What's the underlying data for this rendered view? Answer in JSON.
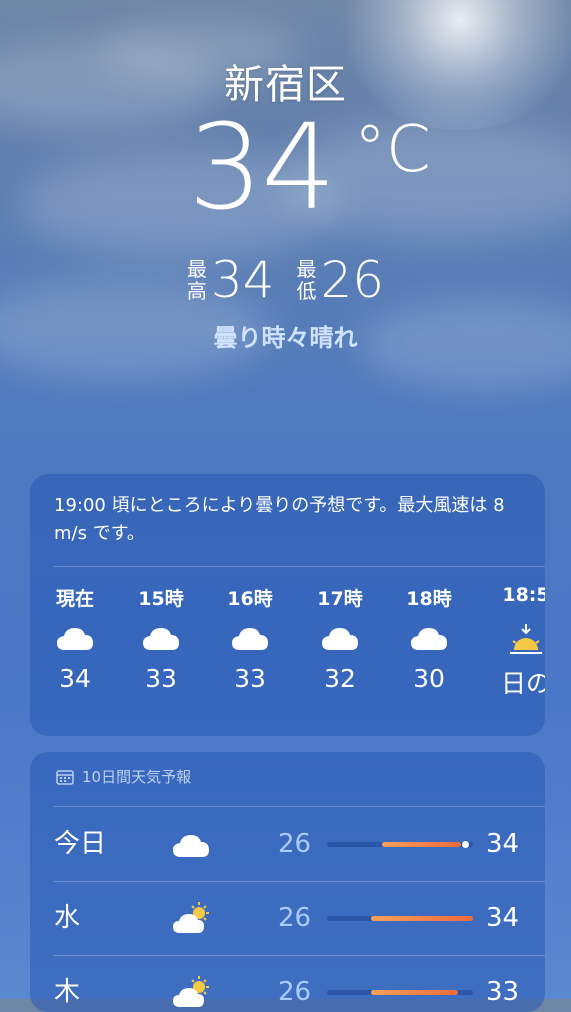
{
  "location": {
    "city": "新宿区"
  },
  "current": {
    "temperature": "34",
    "unit": "°C",
    "high_label_1": "最",
    "high_label_2": "高",
    "high": "34",
    "low_label_1": "最",
    "low_label_2": "低",
    "low": "26",
    "condition": "曇り時々晴れ"
  },
  "hourly": {
    "summary": "19:00 頃にところにより曇りの予想です。最大風速は 8 m/s です。",
    "items": [
      {
        "time": "現在",
        "icon": "cloud-icon",
        "value": "34"
      },
      {
        "time": "15時",
        "icon": "cloud-icon",
        "value": "33"
      },
      {
        "time": "16時",
        "icon": "cloud-icon",
        "value": "33"
      },
      {
        "time": "17時",
        "icon": "cloud-icon",
        "value": "32"
      },
      {
        "time": "18時",
        "icon": "cloud-icon",
        "value": "30"
      },
      {
        "time": "18:5",
        "icon": "sunset-icon",
        "value": "日の"
      }
    ]
  },
  "daily": {
    "title": "10日間天気予報",
    "icon": "calendar-icon",
    "items": [
      {
        "day": "今日",
        "icon": "cloud-icon",
        "low": "26",
        "high": "34",
        "range_start": 0.38,
        "range_end": 0.92,
        "current": 0.95
      },
      {
        "day": "水",
        "icon": "partly-sunny-icon",
        "low": "26",
        "high": "34",
        "range_start": 0.3,
        "range_end": 1.0
      },
      {
        "day": "木",
        "icon": "partly-sunny-icon",
        "low": "26",
        "high": "33",
        "range_start": 0.3,
        "range_end": 0.9
      }
    ]
  },
  "colors": {
    "accent_bar_start": "#f6a15a",
    "accent_bar_end": "#ee6a3a",
    "condition_text": "#cfe3ff",
    "low_temp_text": "#a9ccff"
  }
}
